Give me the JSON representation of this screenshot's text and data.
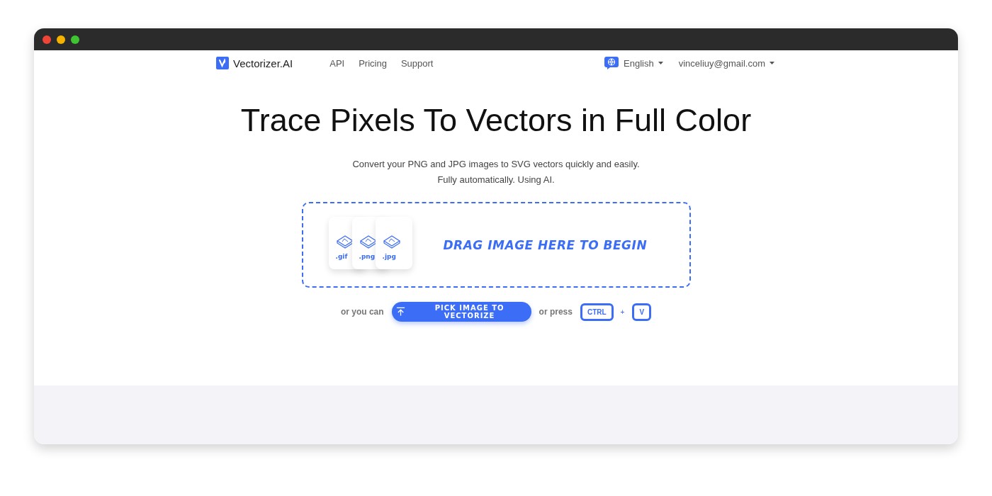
{
  "header": {
    "logo": "Vectorizer.AI",
    "nav": [
      "API",
      "Pricing",
      "Support"
    ],
    "language": "English",
    "account": "vinceliuy@gmail.com"
  },
  "hero": {
    "title": "Trace Pixels To Vectors in Full Color",
    "subtitle_lines": [
      "Convert your PNG and JPG images to SVG vectors quickly and easily.",
      "Fully automatically. Using AI."
    ]
  },
  "dropzone": {
    "file_labels": [
      ".gif",
      ".png",
      ".jpg"
    ],
    "prompt": "DRAG IMAGE HERE TO BEGIN"
  },
  "actions": {
    "lead": "or you can",
    "button": "PICK IMAGE TO VECTORIZE",
    "press": "or press",
    "keys": [
      "CTRL",
      "V"
    ],
    "plus": "+"
  }
}
